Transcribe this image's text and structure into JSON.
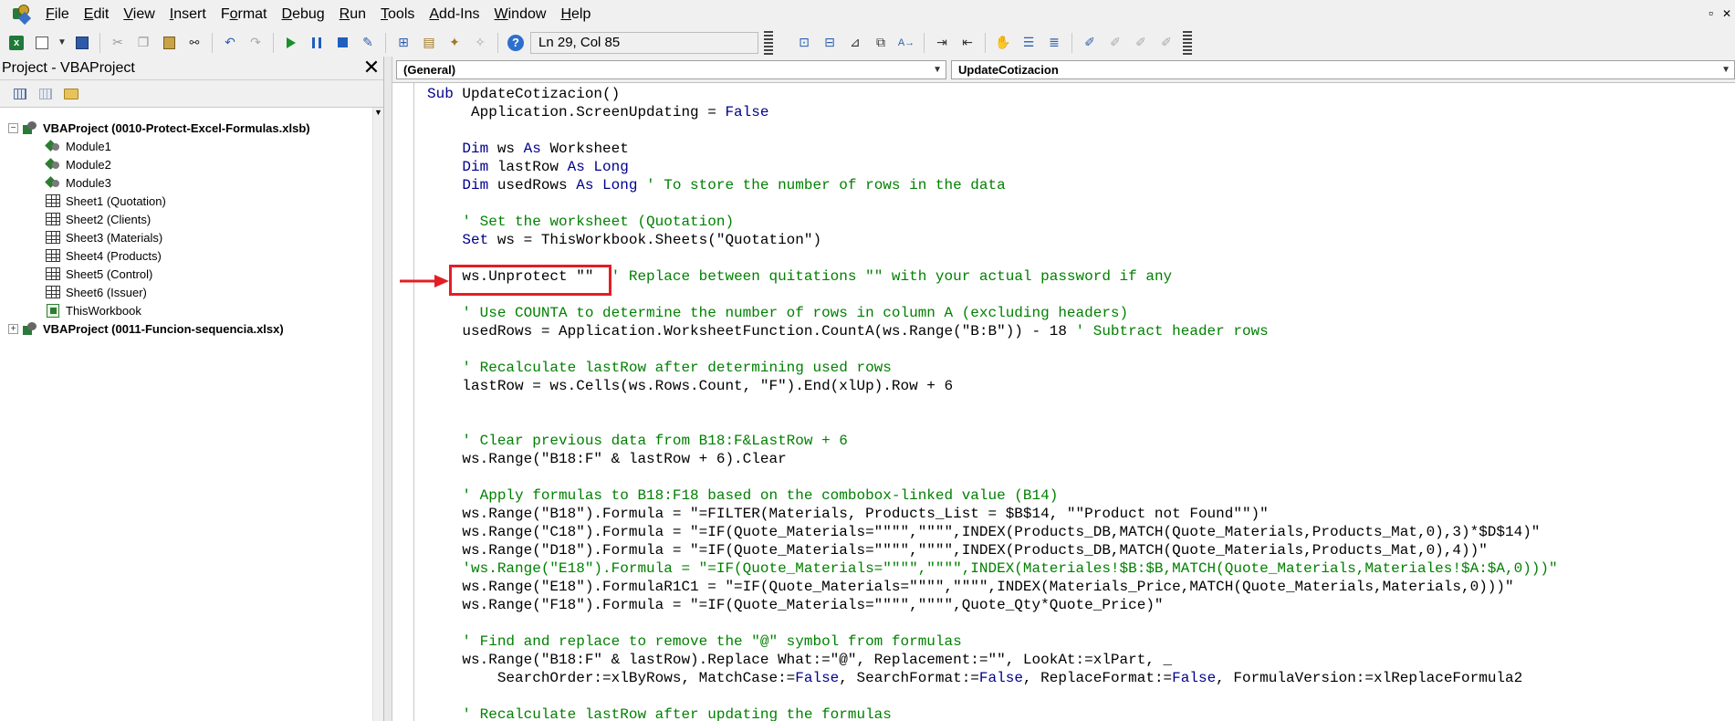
{
  "menu": {
    "items": [
      "File",
      "Edit",
      "View",
      "Insert",
      "Format",
      "Debug",
      "Run",
      "Tools",
      "Add-Ins",
      "Window",
      "Help"
    ],
    "underline": [
      "F",
      "E",
      "V",
      "I",
      "o",
      "D",
      "R",
      "T",
      "A",
      "W",
      "H"
    ]
  },
  "toolbar": {
    "status": "Ln 29, Col 85"
  },
  "project": {
    "title": "Project - VBAProject",
    "close_glyph": "✕",
    "tree": [
      {
        "label": "VBAProject (0010-Protect-Excel-Formulas.xlsb)",
        "level": 0,
        "type": "project",
        "expanded": true
      },
      {
        "label": "Module1",
        "level": 1,
        "type": "module"
      },
      {
        "label": "Module2",
        "level": 1,
        "type": "module"
      },
      {
        "label": "Module3",
        "level": 1,
        "type": "module"
      },
      {
        "label": "Sheet1 (Quotation)",
        "level": 1,
        "type": "sheet"
      },
      {
        "label": "Sheet2 (Clients)",
        "level": 1,
        "type": "sheet"
      },
      {
        "label": "Sheet3 (Materials)",
        "level": 1,
        "type": "sheet"
      },
      {
        "label": "Sheet4 (Products)",
        "level": 1,
        "type": "sheet"
      },
      {
        "label": "Sheet5 (Control)",
        "level": 1,
        "type": "sheet"
      },
      {
        "label": "Sheet6 (Issuer)",
        "level": 1,
        "type": "sheet"
      },
      {
        "label": "ThisWorkbook",
        "level": 1,
        "type": "workbook"
      },
      {
        "label": "VBAProject (0011-Funcion-sequencia.xlsx)",
        "level": 0,
        "type": "project",
        "expanded": false
      }
    ]
  },
  "code_pane": {
    "object_combo": "(General)",
    "procedure_combo": "UpdateCotizacion",
    "lines": [
      [
        [
          "kw",
          "Sub "
        ],
        [
          "t",
          "UpdateCotizacion()"
        ]
      ],
      [
        [
          "t",
          "     Application.ScreenUpdating = "
        ],
        [
          "kw",
          "False"
        ]
      ],
      [
        [
          "t",
          ""
        ]
      ],
      [
        [
          "t",
          "    "
        ],
        [
          "kw",
          "Dim "
        ],
        [
          "t",
          "ws "
        ],
        [
          "kw",
          "As "
        ],
        [
          "t",
          "Worksheet"
        ]
      ],
      [
        [
          "t",
          "    "
        ],
        [
          "kw",
          "Dim "
        ],
        [
          "t",
          "lastRow "
        ],
        [
          "kw",
          "As Long"
        ]
      ],
      [
        [
          "t",
          "    "
        ],
        [
          "kw",
          "Dim "
        ],
        [
          "t",
          "usedRows "
        ],
        [
          "kw",
          "As Long "
        ],
        [
          "cm",
          "' To store the number of rows in the data"
        ]
      ],
      [
        [
          "t",
          ""
        ]
      ],
      [
        [
          "t",
          "    "
        ],
        [
          "cm",
          "' Set the worksheet (Quotation)"
        ]
      ],
      [
        [
          "t",
          "    "
        ],
        [
          "kw",
          "Set "
        ],
        [
          "t",
          "ws = ThisWorkbook.Sheets(\"Quotation\")"
        ]
      ],
      [
        [
          "t",
          ""
        ]
      ],
      [
        [
          "t",
          "    ws.Unprotect \"\"  "
        ],
        [
          "cm",
          "' Replace between quitations \"\" with your actual password if any"
        ]
      ],
      [
        [
          "t",
          ""
        ]
      ],
      [
        [
          "t",
          "    "
        ],
        [
          "cm",
          "' Use COUNTA to determine the number of rows in column A (excluding headers)"
        ]
      ],
      [
        [
          "t",
          "    usedRows = Application.WorksheetFunction.CountA(ws.Range(\"B:B\")) - 18 "
        ],
        [
          "cm",
          "' Subtract header rows"
        ]
      ],
      [
        [
          "t",
          ""
        ]
      ],
      [
        [
          "t",
          "    "
        ],
        [
          "cm",
          "' Recalculate lastRow after determining used rows"
        ]
      ],
      [
        [
          "t",
          "    lastRow = ws.Cells(ws.Rows.Count, \"F\").End(xlUp).Row + 6"
        ]
      ],
      [
        [
          "t",
          ""
        ]
      ],
      [
        [
          "t",
          ""
        ]
      ],
      [
        [
          "t",
          "    "
        ],
        [
          "cm",
          "' Clear previous data from B18:F&LastRow + 6"
        ]
      ],
      [
        [
          "t",
          "    ws.Range(\"B18:F\" & lastRow + 6).Clear"
        ]
      ],
      [
        [
          "t",
          ""
        ]
      ],
      [
        [
          "t",
          "    "
        ],
        [
          "cm",
          "' Apply formulas to B18:F18 based on the combobox-linked value (B14)"
        ]
      ],
      [
        [
          "t",
          "    ws.Range(\"B18\").Formula = \"=FILTER(Materials, Products_List = $B$14, \"\"Product not Found\"\")\""
        ]
      ],
      [
        [
          "t",
          "    ws.Range(\"C18\").Formula = \"=IF(Quote_Materials=\"\"\"\",\"\"\"\",INDEX(Products_DB,MATCH(Quote_Materials,Products_Mat,0),3)*$D$14)\""
        ]
      ],
      [
        [
          "t",
          "    ws.Range(\"D18\").Formula = \"=IF(Quote_Materials=\"\"\"\",\"\"\"\",INDEX(Products_DB,MATCH(Quote_Materials,Products_Mat,0),4))\""
        ]
      ],
      [
        [
          "t",
          "    "
        ],
        [
          "cm",
          "'ws.Range(\"E18\").Formula = \"=IF(Quote_Materials=\"\"\"\",\"\"\"\",INDEX(Materiales!$B:$B,MATCH(Quote_Materials,Materiales!$A:$A,0)))\""
        ]
      ],
      [
        [
          "t",
          "    ws.Range(\"E18\").FormulaR1C1 = \"=IF(Quote_Materials=\"\"\"\",\"\"\"\",INDEX(Materials_Price,MATCH(Quote_Materials,Materials,0)))\""
        ]
      ],
      [
        [
          "t",
          "    ws.Range(\"F18\").Formula = \"=IF(Quote_Materials=\"\"\"\",\"\"\"\",Quote_Qty*Quote_Price)\""
        ]
      ],
      [
        [
          "t",
          ""
        ]
      ],
      [
        [
          "t",
          "    "
        ],
        [
          "cm",
          "' Find and replace to remove the \"@\" symbol from formulas"
        ]
      ],
      [
        [
          "t",
          "    ws.Range(\"B18:F\" & lastRow).Replace What:=\"@\", Replacement:=\"\", LookAt:=xlPart, _"
        ]
      ],
      [
        [
          "t",
          "        SearchOrder:=xlByRows, MatchCase:="
        ],
        [
          "kw",
          "False"
        ],
        [
          "t",
          ", SearchFormat:="
        ],
        [
          "kw",
          "False"
        ],
        [
          "t",
          ", ReplaceFormat:="
        ],
        [
          "kw",
          "False"
        ],
        [
          "t",
          ", FormulaVersion:=xlReplaceFormula2"
        ]
      ],
      [
        [
          "t",
          ""
        ]
      ],
      [
        [
          "t",
          "    "
        ],
        [
          "cm",
          "' Recalculate lastRow after updating the formulas"
        ]
      ]
    ]
  },
  "colors": {
    "keyword": "#00008b",
    "comment": "#008000",
    "annotation": "#e31e24"
  }
}
